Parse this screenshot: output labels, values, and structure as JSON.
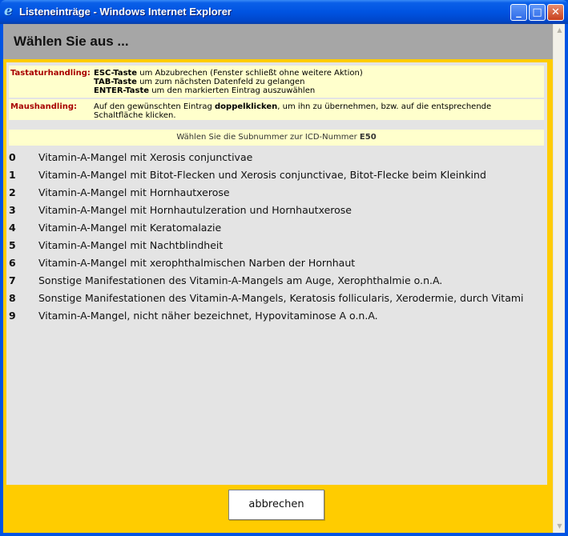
{
  "window": {
    "title": "Listeneinträge - Windows Internet Explorer",
    "minimize_glyph": "_",
    "maximize_glyph": "□",
    "close_glyph": "✕",
    "app_glyph": "e"
  },
  "header": {
    "title": "Wählen Sie aus ..."
  },
  "keyboard": {
    "label": "Tastaturhandling:",
    "lines": [
      {
        "key": "ESC-Taste",
        "text": " um Abzubrechen (Fenster schließt ohne weitere Aktion)"
      },
      {
        "key": "TAB-Taste",
        "text": " um zum nächsten Datenfeld zu gelangen"
      },
      {
        "key": "ENTER-Taste",
        "text": " um den markierten Eintrag auszuwählen"
      }
    ]
  },
  "mouse": {
    "label": "Maushandling:",
    "text_before": "Auf den gewünschten Eintrag ",
    "bold": "doppelklicken",
    "text_after": ", um ihn zu übernehmen, bzw. auf die entsprechende Schaltfläche klicken."
  },
  "subheading": {
    "text": "Wählen Sie die Subnummer zur ICD-Nummer ",
    "code": "E50"
  },
  "items": [
    {
      "num": "0",
      "text": "Vitamin-A-Mangel mit Xerosis conjunctivae"
    },
    {
      "num": "1",
      "text": "Vitamin-A-Mangel mit Bitot-Flecken und Xerosis conjunctivae, Bitot-Flecke beim Kleinkind"
    },
    {
      "num": "2",
      "text": "Vitamin-A-Mangel mit Hornhautxerose"
    },
    {
      "num": "3",
      "text": "Vitamin-A-Mangel mit Hornhautulzeration und Hornhautxerose"
    },
    {
      "num": "4",
      "text": "Vitamin-A-Mangel mit Keratomalazie"
    },
    {
      "num": "5",
      "text": "Vitamin-A-Mangel mit Nachtblindheit"
    },
    {
      "num": "6",
      "text": "Vitamin-A-Mangel mit xerophthalmischen Narben der Hornhaut"
    },
    {
      "num": "7",
      "text": "Sonstige Manifestationen des Vitamin-A-Mangels am Auge, Xerophthalmie o.n.A."
    },
    {
      "num": "8",
      "text": "Sonstige Manifestationen des Vitamin-A-Mangels, Keratosis follicularis, Xerodermie, durch Vitami"
    },
    {
      "num": "9",
      "text": "Vitamin-A-Mangel, nicht näher bezeichnet, Hypovitaminose A o.n.A."
    }
  ],
  "cancel_button": {
    "label": "abbrechen"
  },
  "colors": {
    "accent": "#ffcc00",
    "header": "#a6a6a6",
    "info_bg": "#ffffcc",
    "label_red": "#a80000"
  }
}
